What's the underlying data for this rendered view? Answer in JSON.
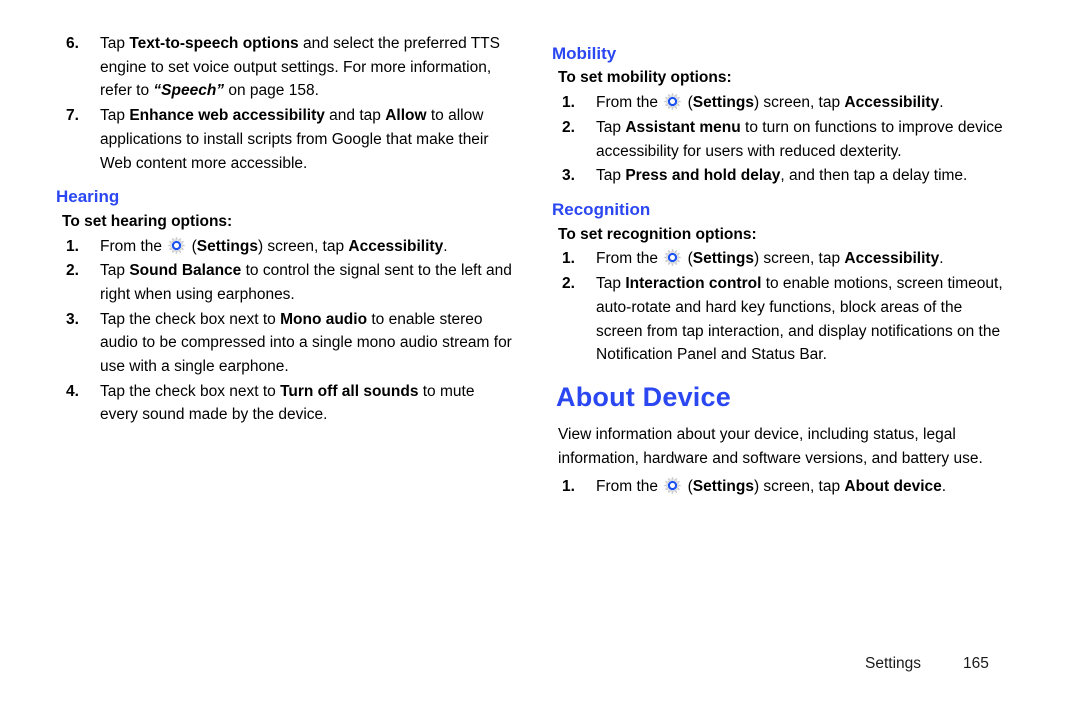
{
  "page": {
    "footer_label": "Settings",
    "footer_page_number": "165",
    "heading_color": "#2a47f2",
    "text_color": "#000000",
    "background_color": "#ffffff"
  },
  "icons": {
    "settings_gear": "settings-gear-icon"
  },
  "left_column": {
    "continued_steps": [
      {
        "number": "6.",
        "parts": [
          {
            "t": "Tap ",
            "s": "normal"
          },
          {
            "t": "Text-to-speech options",
            "s": "bold"
          },
          {
            "t": " and select the preferred TTS engine to set voice output settings. For more information, refer to ",
            "s": "normal"
          },
          {
            "t": "“Speech”",
            "s": "bold-italic"
          },
          {
            "t": " on page 158.",
            "s": "normal"
          }
        ]
      },
      {
        "number": "7.",
        "parts": [
          {
            "t": "Tap ",
            "s": "normal"
          },
          {
            "t": "Enhance web accessibility",
            "s": "bold"
          },
          {
            "t": " and tap ",
            "s": "normal"
          },
          {
            "t": "Allow",
            "s": "bold"
          },
          {
            "t": " to allow applications to install scripts from Google that make their Web content more accessible.",
            "s": "normal"
          }
        ]
      }
    ],
    "hearing": {
      "title": "Hearing",
      "lead_in": "To set hearing options:",
      "steps": [
        {
          "number": "1.",
          "parts": [
            {
              "t": "From the ",
              "s": "normal"
            },
            {
              "t": "",
              "s": "gear"
            },
            {
              "t": " (",
              "s": "normal"
            },
            {
              "t": "Settings",
              "s": "bold"
            },
            {
              "t": ") screen, tap ",
              "s": "normal"
            },
            {
              "t": "Accessibility",
              "s": "bold"
            },
            {
              "t": ".",
              "s": "normal"
            }
          ]
        },
        {
          "number": "2.",
          "parts": [
            {
              "t": "Tap ",
              "s": "normal"
            },
            {
              "t": "Sound Balance",
              "s": "bold"
            },
            {
              "t": " to control the signal sent to the left and right when using earphones.",
              "s": "normal"
            }
          ]
        },
        {
          "number": "3.",
          "parts": [
            {
              "t": "Tap the check box next to ",
              "s": "normal"
            },
            {
              "t": "Mono audio",
              "s": "bold"
            },
            {
              "t": " to enable stereo audio to be compressed into a single mono audio stream for use with a single earphone.",
              "s": "normal"
            }
          ]
        },
        {
          "number": "4.",
          "parts": [
            {
              "t": "Tap the check box next to ",
              "s": "normal"
            },
            {
              "t": "Turn off all sounds",
              "s": "bold"
            },
            {
              "t": " to mute every sound made by the device.",
              "s": "normal"
            }
          ]
        }
      ]
    }
  },
  "right_column": {
    "mobility": {
      "title": "Mobility",
      "lead_in": "To set mobility options:",
      "steps": [
        {
          "number": "1.",
          "parts": [
            {
              "t": "From the ",
              "s": "normal"
            },
            {
              "t": "",
              "s": "gear"
            },
            {
              "t": " (",
              "s": "normal"
            },
            {
              "t": "Settings",
              "s": "bold"
            },
            {
              "t": ") screen, tap ",
              "s": "normal"
            },
            {
              "t": "Accessibility",
              "s": "bold"
            },
            {
              "t": ".",
              "s": "normal"
            }
          ]
        },
        {
          "number": "2.",
          "parts": [
            {
              "t": "Tap ",
              "s": "normal"
            },
            {
              "t": "Assistant menu",
              "s": "bold"
            },
            {
              "t": " to turn on functions to improve device accessibility for users with reduced dexterity.",
              "s": "normal"
            }
          ]
        },
        {
          "number": "3.",
          "parts": [
            {
              "t": "Tap ",
              "s": "normal"
            },
            {
              "t": "Press and hold delay",
              "s": "bold"
            },
            {
              "t": ", and then tap a delay time.",
              "s": "normal"
            }
          ]
        }
      ]
    },
    "recognition": {
      "title": "Recognition",
      "lead_in": "To set recognition options:",
      "steps": [
        {
          "number": "1.",
          "parts": [
            {
              "t": "From the ",
              "s": "normal"
            },
            {
              "t": "",
              "s": "gear"
            },
            {
              "t": " (",
              "s": "normal"
            },
            {
              "t": "Settings",
              "s": "bold"
            },
            {
              "t": ") screen, tap ",
              "s": "normal"
            },
            {
              "t": "Accessibility",
              "s": "bold"
            },
            {
              "t": ".",
              "s": "normal"
            }
          ]
        },
        {
          "number": "2.",
          "parts": [
            {
              "t": "Tap ",
              "s": "normal"
            },
            {
              "t": "Interaction control",
              "s": "bold"
            },
            {
              "t": " to enable motions, screen timeout, auto-rotate and hard key functions, block areas of the screen from tap interaction, and display notifications on the Notification Panel and Status Bar.",
              "s": "normal"
            }
          ]
        }
      ]
    },
    "about_device": {
      "title": "About Device",
      "body": "View information about your device, including status, legal information, hardware and software versions, and battery use.",
      "steps": [
        {
          "number": "1.",
          "parts": [
            {
              "t": "From the ",
              "s": "normal"
            },
            {
              "t": "",
              "s": "gear"
            },
            {
              "t": " (",
              "s": "normal"
            },
            {
              "t": "Settings",
              "s": "bold"
            },
            {
              "t": ") screen, tap ",
              "s": "normal"
            },
            {
              "t": "About device",
              "s": "bold"
            },
            {
              "t": ".",
              "s": "normal"
            }
          ]
        }
      ]
    }
  }
}
